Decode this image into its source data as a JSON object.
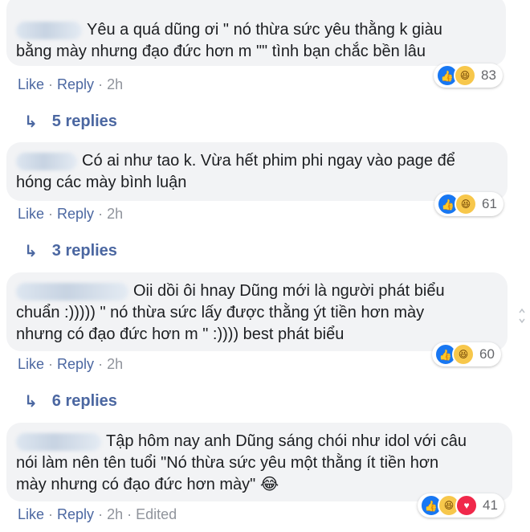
{
  "comments": [
    {
      "text_line1": "Yêu a quá dũng ơi \" nó thừa sức yêu thằng k giàu",
      "text_line2": "bằng mày nhưng đạo đức hơn m \"\" tình bạn chắc bền lâu",
      "like": "Like",
      "reply": "Reply",
      "time": "2h",
      "reaction_count": "83",
      "replies": "5 replies"
    },
    {
      "text_line1": "Có ai như tao k. Vừa hết phim phi ngay vào page để",
      "text_line2": "hóng các mày bình luận",
      "like": "Like",
      "reply": "Reply",
      "time": "2h",
      "reaction_count": "61",
      "replies": "3 replies"
    },
    {
      "text_line1": "Oii dồi ôi hnay Dũng mới là người phát biểu",
      "text_line2": "chuẩn :))))) \" nó thừa sức lấy được thằng ýt tiền hơn mày",
      "text_line3": "nhưng có đạo đức hơn m \" :)))) best phát biểu",
      "like": "Like",
      "reply": "Reply",
      "time": "2h",
      "reaction_count": "60",
      "replies": "6 replies"
    },
    {
      "text_line1": "Tập hôm nay anh Dũng sáng chói như idol với câu",
      "text_line2": "nói làm nên tên tuổi \"Nó thừa sức yêu một thằng ít tiền hơn",
      "text_line3": "mày nhưng có đạo đức hơn mày\"",
      "emoji": "😂",
      "like": "Like",
      "reply": "Reply",
      "time": "2h",
      "edited": "Edited",
      "reaction_count": "41"
    }
  ],
  "icons": {
    "like": "like-reaction-icon",
    "haha": "haha-reaction-icon",
    "love": "love-reaction-icon",
    "reply_arrow": "reply-arrow-icon"
  },
  "colors": {
    "bubble": "#f2f3f5",
    "link": "#4b67a1",
    "meta": "#90949c",
    "like_blue": "#1877f2",
    "haha_yellow": "#f7c74b",
    "love_red": "#f0284a"
  }
}
